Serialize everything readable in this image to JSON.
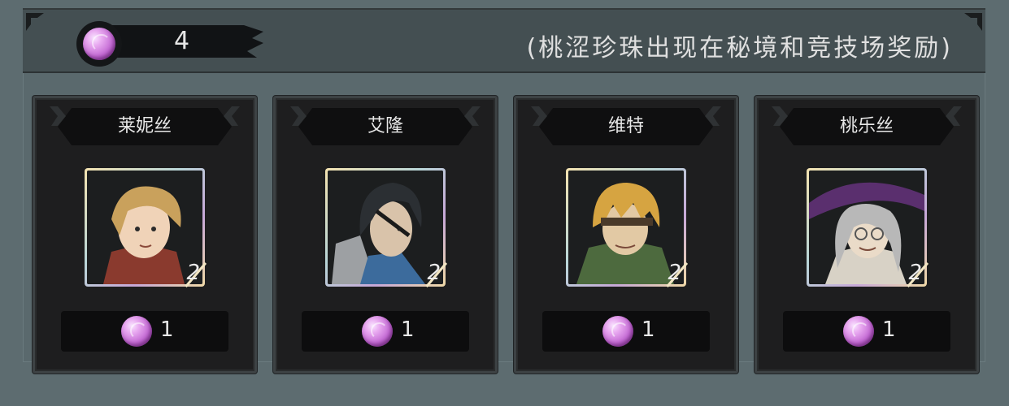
{
  "header": {
    "currency_icon": "pink-pearl-icon",
    "currency_count": "4",
    "note": "(桃涩珍珠出现在秘境和竞技场奖励)"
  },
  "colors": {
    "background": "#5d6c70",
    "header": "#444f52",
    "card": "#1e1e1f",
    "pearl": "#c46bd4"
  },
  "cards": [
    {
      "name": "莱妮丝",
      "level": "2",
      "cost": "1",
      "hair": "#c9a15c",
      "cloth": "#8a3a2e"
    },
    {
      "name": "艾隆",
      "level": "2",
      "cost": "1",
      "hair": "#2b2f33",
      "cloth": "#3c6b9c"
    },
    {
      "name": "维特",
      "level": "2",
      "cost": "1",
      "hair": "#d6a441",
      "cloth": "#4d6a3e"
    },
    {
      "name": "桃乐丝",
      "level": "2",
      "cost": "1",
      "hair": "#b8b8b8",
      "cloth": "#5a2f6e"
    }
  ]
}
